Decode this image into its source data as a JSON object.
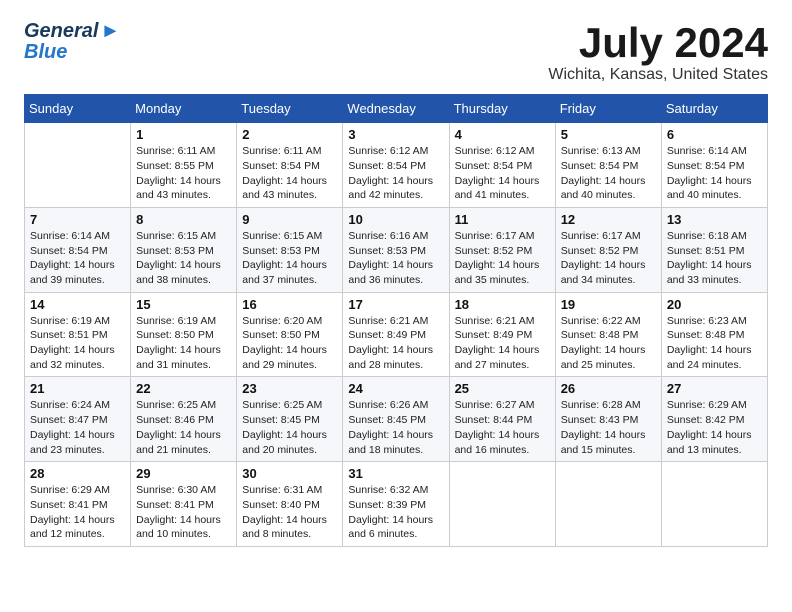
{
  "brand": {
    "name_general": "General",
    "name_blue": "Blue",
    "arrow": "▶"
  },
  "title": "July 2024",
  "subtitle": "Wichita, Kansas, United States",
  "days_of_week": [
    "Sunday",
    "Monday",
    "Tuesday",
    "Wednesday",
    "Thursday",
    "Friday",
    "Saturday"
  ],
  "weeks": [
    [
      {
        "num": "",
        "sunrise": "",
        "sunset": "",
        "daylight": ""
      },
      {
        "num": "1",
        "sunrise": "Sunrise: 6:11 AM",
        "sunset": "Sunset: 8:55 PM",
        "daylight": "Daylight: 14 hours and 43 minutes."
      },
      {
        "num": "2",
        "sunrise": "Sunrise: 6:11 AM",
        "sunset": "Sunset: 8:54 PM",
        "daylight": "Daylight: 14 hours and 43 minutes."
      },
      {
        "num": "3",
        "sunrise": "Sunrise: 6:12 AM",
        "sunset": "Sunset: 8:54 PM",
        "daylight": "Daylight: 14 hours and 42 minutes."
      },
      {
        "num": "4",
        "sunrise": "Sunrise: 6:12 AM",
        "sunset": "Sunset: 8:54 PM",
        "daylight": "Daylight: 14 hours and 41 minutes."
      },
      {
        "num": "5",
        "sunrise": "Sunrise: 6:13 AM",
        "sunset": "Sunset: 8:54 PM",
        "daylight": "Daylight: 14 hours and 40 minutes."
      },
      {
        "num": "6",
        "sunrise": "Sunrise: 6:14 AM",
        "sunset": "Sunset: 8:54 PM",
        "daylight": "Daylight: 14 hours and 40 minutes."
      }
    ],
    [
      {
        "num": "7",
        "sunrise": "Sunrise: 6:14 AM",
        "sunset": "Sunset: 8:54 PM",
        "daylight": "Daylight: 14 hours and 39 minutes."
      },
      {
        "num": "8",
        "sunrise": "Sunrise: 6:15 AM",
        "sunset": "Sunset: 8:53 PM",
        "daylight": "Daylight: 14 hours and 38 minutes."
      },
      {
        "num": "9",
        "sunrise": "Sunrise: 6:15 AM",
        "sunset": "Sunset: 8:53 PM",
        "daylight": "Daylight: 14 hours and 37 minutes."
      },
      {
        "num": "10",
        "sunrise": "Sunrise: 6:16 AM",
        "sunset": "Sunset: 8:53 PM",
        "daylight": "Daylight: 14 hours and 36 minutes."
      },
      {
        "num": "11",
        "sunrise": "Sunrise: 6:17 AM",
        "sunset": "Sunset: 8:52 PM",
        "daylight": "Daylight: 14 hours and 35 minutes."
      },
      {
        "num": "12",
        "sunrise": "Sunrise: 6:17 AM",
        "sunset": "Sunset: 8:52 PM",
        "daylight": "Daylight: 14 hours and 34 minutes."
      },
      {
        "num": "13",
        "sunrise": "Sunrise: 6:18 AM",
        "sunset": "Sunset: 8:51 PM",
        "daylight": "Daylight: 14 hours and 33 minutes."
      }
    ],
    [
      {
        "num": "14",
        "sunrise": "Sunrise: 6:19 AM",
        "sunset": "Sunset: 8:51 PM",
        "daylight": "Daylight: 14 hours and 32 minutes."
      },
      {
        "num": "15",
        "sunrise": "Sunrise: 6:19 AM",
        "sunset": "Sunset: 8:50 PM",
        "daylight": "Daylight: 14 hours and 31 minutes."
      },
      {
        "num": "16",
        "sunrise": "Sunrise: 6:20 AM",
        "sunset": "Sunset: 8:50 PM",
        "daylight": "Daylight: 14 hours and 29 minutes."
      },
      {
        "num": "17",
        "sunrise": "Sunrise: 6:21 AM",
        "sunset": "Sunset: 8:49 PM",
        "daylight": "Daylight: 14 hours and 28 minutes."
      },
      {
        "num": "18",
        "sunrise": "Sunrise: 6:21 AM",
        "sunset": "Sunset: 8:49 PM",
        "daylight": "Daylight: 14 hours and 27 minutes."
      },
      {
        "num": "19",
        "sunrise": "Sunrise: 6:22 AM",
        "sunset": "Sunset: 8:48 PM",
        "daylight": "Daylight: 14 hours and 25 minutes."
      },
      {
        "num": "20",
        "sunrise": "Sunrise: 6:23 AM",
        "sunset": "Sunset: 8:48 PM",
        "daylight": "Daylight: 14 hours and 24 minutes."
      }
    ],
    [
      {
        "num": "21",
        "sunrise": "Sunrise: 6:24 AM",
        "sunset": "Sunset: 8:47 PM",
        "daylight": "Daylight: 14 hours and 23 minutes."
      },
      {
        "num": "22",
        "sunrise": "Sunrise: 6:25 AM",
        "sunset": "Sunset: 8:46 PM",
        "daylight": "Daylight: 14 hours and 21 minutes."
      },
      {
        "num": "23",
        "sunrise": "Sunrise: 6:25 AM",
        "sunset": "Sunset: 8:45 PM",
        "daylight": "Daylight: 14 hours and 20 minutes."
      },
      {
        "num": "24",
        "sunrise": "Sunrise: 6:26 AM",
        "sunset": "Sunset: 8:45 PM",
        "daylight": "Daylight: 14 hours and 18 minutes."
      },
      {
        "num": "25",
        "sunrise": "Sunrise: 6:27 AM",
        "sunset": "Sunset: 8:44 PM",
        "daylight": "Daylight: 14 hours and 16 minutes."
      },
      {
        "num": "26",
        "sunrise": "Sunrise: 6:28 AM",
        "sunset": "Sunset: 8:43 PM",
        "daylight": "Daylight: 14 hours and 15 minutes."
      },
      {
        "num": "27",
        "sunrise": "Sunrise: 6:29 AM",
        "sunset": "Sunset: 8:42 PM",
        "daylight": "Daylight: 14 hours and 13 minutes."
      }
    ],
    [
      {
        "num": "28",
        "sunrise": "Sunrise: 6:29 AM",
        "sunset": "Sunset: 8:41 PM",
        "daylight": "Daylight: 14 hours and 12 minutes."
      },
      {
        "num": "29",
        "sunrise": "Sunrise: 6:30 AM",
        "sunset": "Sunset: 8:41 PM",
        "daylight": "Daylight: 14 hours and 10 minutes."
      },
      {
        "num": "30",
        "sunrise": "Sunrise: 6:31 AM",
        "sunset": "Sunset: 8:40 PM",
        "daylight": "Daylight: 14 hours and 8 minutes."
      },
      {
        "num": "31",
        "sunrise": "Sunrise: 6:32 AM",
        "sunset": "Sunset: 8:39 PM",
        "daylight": "Daylight: 14 hours and 6 minutes."
      },
      {
        "num": "",
        "sunrise": "",
        "sunset": "",
        "daylight": ""
      },
      {
        "num": "",
        "sunrise": "",
        "sunset": "",
        "daylight": ""
      },
      {
        "num": "",
        "sunrise": "",
        "sunset": "",
        "daylight": ""
      }
    ]
  ]
}
